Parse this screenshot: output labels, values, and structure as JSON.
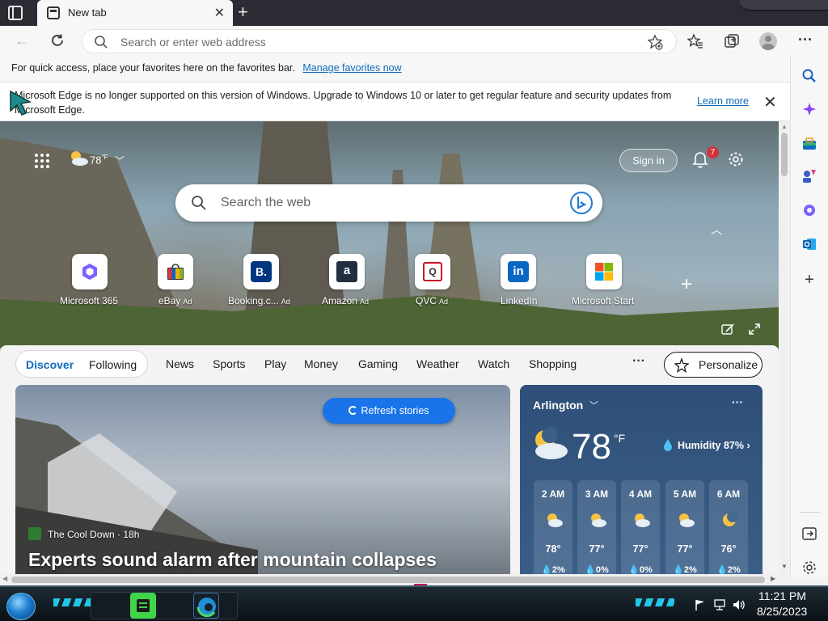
{
  "browser": {
    "tab_title": "New tab",
    "address_placeholder": "Search or enter web address",
    "favorites_bar_text": "For quick access, place your favorites here on the favorites bar.",
    "favorites_bar_link": "Manage favorites now",
    "notice_text": "Microsoft Edge is no longer supported on this version of Windows. Upgrade to Windows 10 or later to get regular feature and security updates from Microsoft Edge.",
    "notice_link": "Learn more"
  },
  "sidebar_icons": [
    "search-icon",
    "copilot-icon",
    "shopping-icon",
    "people-icon",
    "office-icon",
    "outlook-icon",
    "add-icon",
    "panel-icon",
    "settings-icon"
  ],
  "hero": {
    "weather_temp": "78",
    "weather_unit": "°F",
    "signin_label": "Sign in",
    "notification_count": "7",
    "search_placeholder": "Search the web",
    "tiles": [
      {
        "label": "Microsoft 365",
        "ad": "",
        "icon": "m365-icon"
      },
      {
        "label": "eBay",
        "ad": "Ad",
        "icon": "ebay-icon"
      },
      {
        "label": "Booking.c...",
        "ad": "Ad",
        "icon": "booking-icon"
      },
      {
        "label": "Amazon",
        "ad": "Ad",
        "icon": "amazon-icon"
      },
      {
        "label": "QVC",
        "ad": "Ad",
        "icon": "qvc-icon"
      },
      {
        "label": "LinkedIn",
        "ad": "",
        "icon": "linkedin-icon"
      },
      {
        "label": "Microsoft Start",
        "ad": "",
        "icon": "microsoft-start-icon"
      }
    ]
  },
  "feed": {
    "pill_discover": "Discover",
    "pill_following": "Following",
    "nav": [
      "News",
      "Sports",
      "Play",
      "Money",
      "Gaming",
      "Weather",
      "Watch",
      "Shopping"
    ],
    "more": "···",
    "personalize_label": "Personalize",
    "refresh_label": "Refresh stories",
    "story_source": "The Cool Down · 18h",
    "story_headline": "Experts sound alarm after mountain collapses"
  },
  "weather_card": {
    "city": "Arlington",
    "temp": "78",
    "unit": "°F",
    "humidity": "Humidity 87%",
    "more": "···",
    "hourly": [
      {
        "time": "2 AM",
        "temp": "78°",
        "precip": "2%",
        "icon": "partly-cloudy-night-icon"
      },
      {
        "time": "3 AM",
        "temp": "77°",
        "precip": "0%",
        "icon": "partly-cloudy-night-icon"
      },
      {
        "time": "4 AM",
        "temp": "77°",
        "precip": "0%",
        "icon": "partly-cloudy-night-icon"
      },
      {
        "time": "5 AM",
        "temp": "77°",
        "precip": "2%",
        "icon": "partly-cloudy-night-icon"
      },
      {
        "time": "6 AM",
        "temp": "76°",
        "precip": "2%",
        "icon": "moon-icon"
      }
    ]
  },
  "taskbar": {
    "time": "11:21 PM",
    "date": "8/25/2023"
  }
}
